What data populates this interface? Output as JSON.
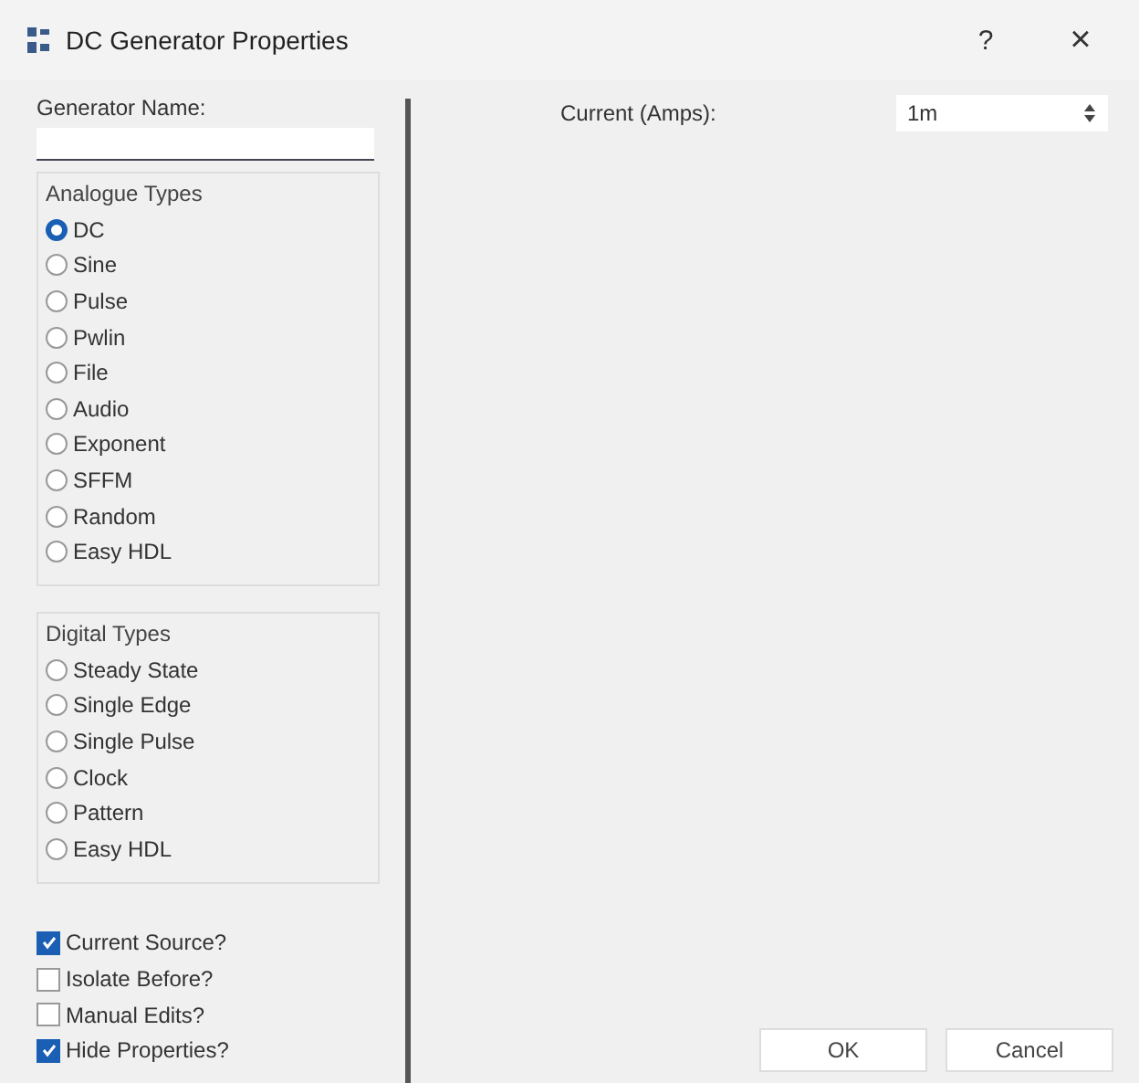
{
  "window": {
    "title": "DC Generator Properties",
    "help": "?",
    "close": "×"
  },
  "generator_name": {
    "label": "Generator Name:"
  },
  "analogue_types": {
    "title": "Analogue Types",
    "options": [
      {
        "label": "DC",
        "selected": true
      },
      {
        "label": "Sine",
        "selected": false
      },
      {
        "label": "Pulse",
        "selected": false
      },
      {
        "label": "Pwlin",
        "selected": false
      },
      {
        "label": "File",
        "selected": false
      },
      {
        "label": "Audio",
        "selected": false
      },
      {
        "label": "Exponent",
        "selected": false
      },
      {
        "label": "SFFM",
        "selected": false
      },
      {
        "label": "Random",
        "selected": false
      },
      {
        "label": "Easy HDL",
        "selected": false
      }
    ]
  },
  "digital_types": {
    "title": "Digital Types",
    "options": [
      {
        "label": "Steady State",
        "selected": false
      },
      {
        "label": "Single Edge",
        "selected": false
      },
      {
        "label": "Single Pulse",
        "selected": false
      },
      {
        "label": "Clock",
        "selected": false
      },
      {
        "label": "Pattern",
        "selected": false
      },
      {
        "label": "Easy HDL",
        "selected": false
      }
    ]
  },
  "checkboxes": [
    {
      "label": "Current Source?",
      "checked": true
    },
    {
      "label": "Isolate Before?",
      "checked": false
    },
    {
      "label": "Manual Edits?",
      "checked": false
    },
    {
      "label": "Hide Properties?",
      "checked": true
    }
  ],
  "current": {
    "label": "Current (Amps):",
    "value": "1m"
  },
  "buttons": [
    "OK",
    "Cancel"
  ]
}
